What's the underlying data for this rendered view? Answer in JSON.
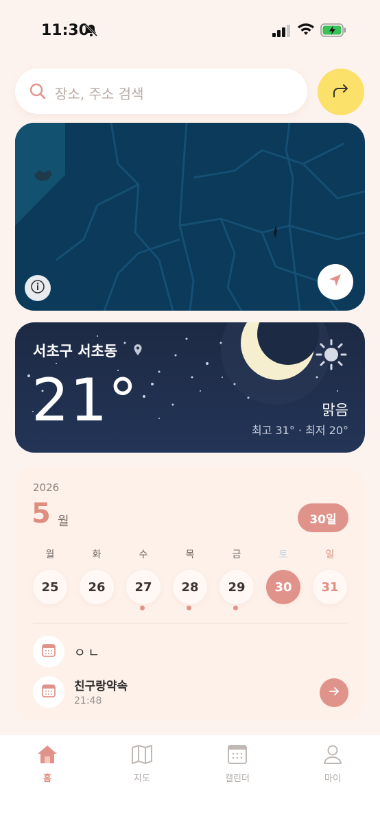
{
  "status_bar": {
    "time": "11:30"
  },
  "search": {
    "placeholder": "장소, 주소 검색"
  },
  "weather": {
    "location": "서초구 서초동",
    "temperature": "21°",
    "condition": "맑음",
    "range": "최고 31° · 최저 20°"
  },
  "calendar": {
    "year": "2026",
    "month": "5",
    "month_label": "월",
    "today_badge": "30일",
    "weekdays": [
      "월",
      "화",
      "수",
      "목",
      "금",
      "토",
      "일"
    ],
    "days": [
      "25",
      "26",
      "27",
      "28",
      "29",
      "30",
      "31"
    ],
    "selected_day": "30",
    "days_with_events": [
      "27",
      "28",
      "29"
    ]
  },
  "events": [
    {
      "title": "ㅇㄴ",
      "time": ""
    },
    {
      "title": "친구랑약속",
      "time": "21:48"
    }
  ],
  "tabs": [
    {
      "label": "홈",
      "icon": "home-icon",
      "active": true
    },
    {
      "label": "지도",
      "icon": "map-icon",
      "active": false
    },
    {
      "label": "캘린더",
      "icon": "calendar-icon",
      "active": false
    },
    {
      "label": "마이",
      "icon": "person-icon",
      "active": false
    }
  ],
  "colors": {
    "accent": "#e0938a",
    "background": "#fdf3ee",
    "go_button": "#fbe06a",
    "map": "#0b3a5a",
    "weather": "#1d2a44"
  }
}
